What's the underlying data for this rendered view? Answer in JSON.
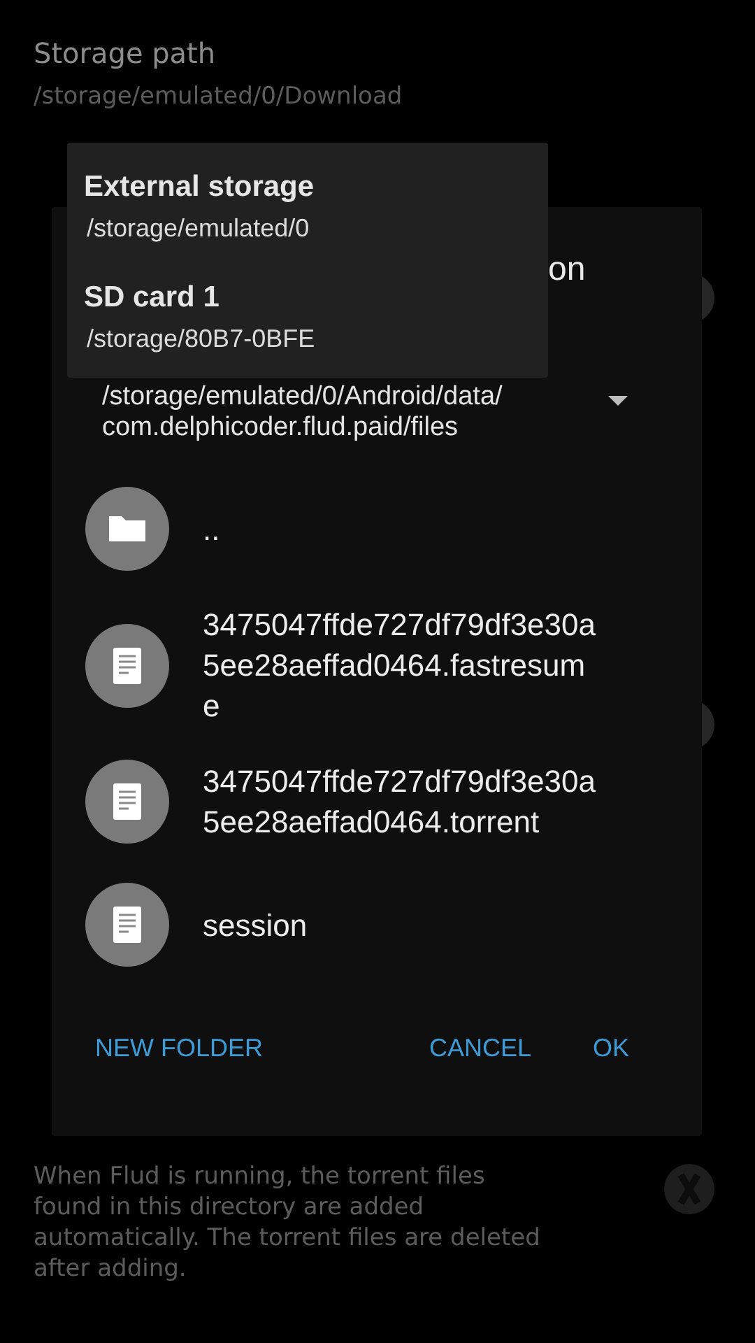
{
  "settings": [
    {
      "kind": "text",
      "title": "Storage path",
      "summary": [
        "/storage/emulated/0/Download"
      ]
    },
    {
      "kind": "switch"
    },
    {
      "kind": "switch"
    },
    {
      "summary": [
        "When Flud is running, the torrent files",
        "found in this directory are added",
        "automatically. The torrent files are deleted",
        "after adding."
      ],
      "kind": "disabled_switch"
    }
  ],
  "dialog": {
    "title": "on",
    "path": "/storage/emulated/0/Android/data/com.delphicoder.flud.paid/files",
    "files": [
      {
        "kind": "folder",
        "name": ".."
      },
      {
        "kind": "file",
        "name": "3475047ffde727df79df3e30a5ee28aeffad0464.fastresume"
      },
      {
        "kind": "file",
        "name": "3475047ffde727df79df3e30a5ee28aeffad0464.torrent"
      },
      {
        "kind": "file",
        "name": "session"
      }
    ],
    "buttons": [
      {
        "kind": "left",
        "label": "NEW FOLDER"
      },
      {
        "kind": "right",
        "label": "CANCEL"
      },
      {
        "kind": "right",
        "label": "OK"
      }
    ]
  },
  "storage_menu": [
    {
      "name": "External storage",
      "path": "/storage/emulated/0"
    },
    {
      "name": "SD card 1",
      "path": "/storage/80B7-0BFE"
    }
  ]
}
